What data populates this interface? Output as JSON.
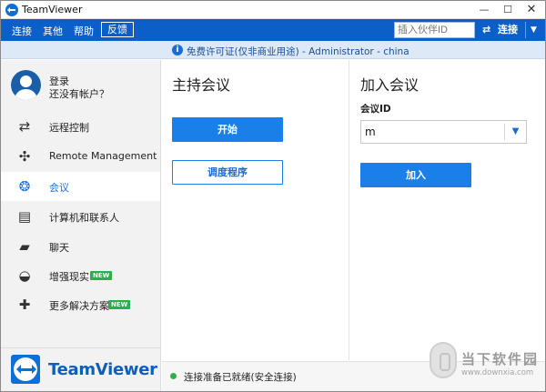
{
  "window": {
    "title": "TeamViewer",
    "controls": {
      "minimize": "—",
      "maximize": "☐",
      "close": "✕"
    }
  },
  "menubar": {
    "items": [
      "连接",
      "其他",
      "帮助"
    ],
    "feedback": "反馈",
    "partner_id_placeholder": "插入伙伴ID",
    "connect_label": "连接",
    "connect_icon": "swap-arrows-icon"
  },
  "infobar": {
    "text": "免费许可证(仅非商业用途) - Administrator - china"
  },
  "sidebar": {
    "login": "登录",
    "no_account": "还没有帐户？",
    "items": [
      {
        "label": "远程控制",
        "icon": "remote-control-icon",
        "glyph": "⇄",
        "active": false,
        "badge": ""
      },
      {
        "label": "Remote Management",
        "icon": "remote-management-icon",
        "glyph": "✣",
        "active": false,
        "badge": ""
      },
      {
        "label": "会议",
        "icon": "meeting-icon",
        "glyph": "❂",
        "active": true,
        "badge": ""
      },
      {
        "label": "计算机和联系人",
        "icon": "contacts-icon",
        "glyph": "▤",
        "active": false,
        "badge": ""
      },
      {
        "label": "聊天",
        "icon": "chat-icon",
        "glyph": "▰",
        "active": false,
        "badge": ""
      },
      {
        "label": "增强现实",
        "icon": "augmented-reality-icon",
        "glyph": "◒",
        "active": false,
        "badge": "NEW"
      },
      {
        "label": "更多解决方案",
        "icon": "more-solutions-icon",
        "glyph": "✚",
        "active": false,
        "badge": "NEW"
      }
    ],
    "brand": "TeamViewer"
  },
  "host": {
    "title": "主持会议",
    "start": "开始",
    "schedule": "调度程序"
  },
  "join": {
    "title": "加入会议",
    "meeting_id_label": "会议ID",
    "meeting_id_value": "m",
    "join": "加入"
  },
  "status": {
    "text": "连接准备已就绪(安全连接)",
    "color": "#2bb24c"
  },
  "watermark": {
    "title": "当下软件园",
    "url": "www.downxia.com"
  },
  "colors": {
    "accent": "#1a7fe8",
    "menubar": "#0c5fc9",
    "infobar": "#dde9f7",
    "new_badge": "#26b24b"
  }
}
